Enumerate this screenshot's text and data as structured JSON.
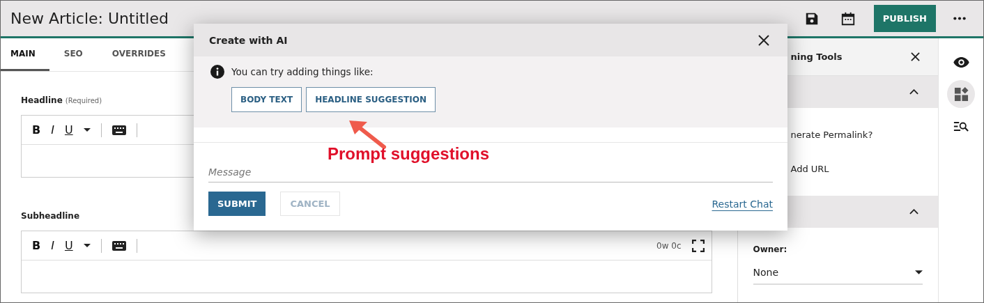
{
  "header": {
    "title": "New Article: Untitled",
    "publish": "PUBLISH"
  },
  "tabs": [
    {
      "label": "MAIN",
      "selected": true
    },
    {
      "label": "SEO",
      "selected": false
    },
    {
      "label": "OVERRIDES",
      "selected": false
    }
  ],
  "fields": [
    {
      "label": "Headline",
      "note": "(Required)",
      "toolbar": {
        "bold": "B",
        "italic": "I",
        "underline": "U"
      }
    },
    {
      "label": "Subheadline",
      "counter": "0w 0c",
      "toolbar": {
        "bold": "B",
        "italic": "I",
        "underline": "U"
      }
    }
  ],
  "side_panel": {
    "title": "ning Tools",
    "sections": [
      {
        "kind": "links",
        "expanded": true,
        "items": [
          "nerate Permalink?",
          "Add URL"
        ]
      },
      {
        "kind": "owner",
        "expanded": true,
        "label": "Owner:",
        "value": "None"
      }
    ]
  },
  "rail": [
    {
      "kind": "eye",
      "selected": false
    },
    {
      "kind": "widgets",
      "selected": true
    },
    {
      "kind": "search-list",
      "selected": false
    }
  ],
  "dialog": {
    "title": "Create with AI",
    "hint": "You can try adding things like:",
    "suggestions": [
      "BODY TEXT",
      "HEADLINE SUGGESTION"
    ],
    "placeholder": "Message",
    "submit": "SUBMIT",
    "cancel": {
      "label": "CANCEL",
      "disabled": true
    },
    "restart": "Restart Chat"
  },
  "annotation": {
    "text": "Prompt suggestions"
  }
}
